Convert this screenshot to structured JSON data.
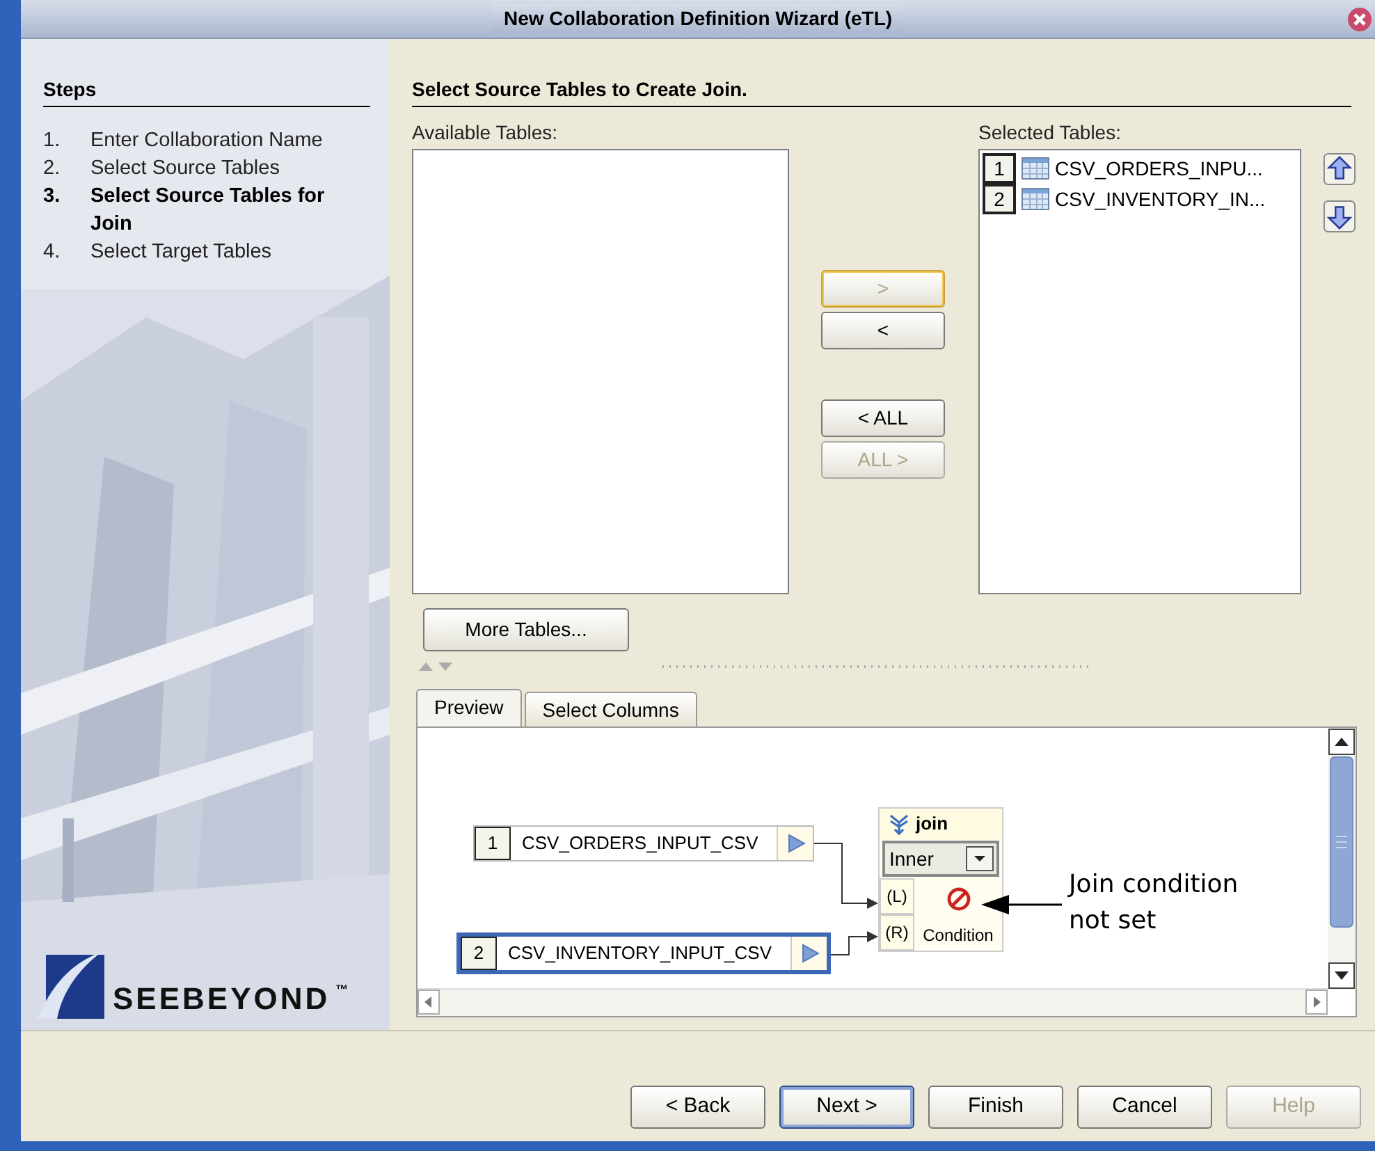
{
  "window": {
    "title": "New Collaboration Definition Wizard (eTL)"
  },
  "steps": {
    "heading": "Steps",
    "items": [
      {
        "number": "1.",
        "label": "Enter Collaboration Name",
        "selected": false
      },
      {
        "number": "2.",
        "label": "Select Source Tables",
        "selected": false
      },
      {
        "number": "3.",
        "label": "Select Source Tables for Join",
        "selected": true
      },
      {
        "number": "4.",
        "label": "Select Target Tables",
        "selected": false
      }
    ]
  },
  "logo": {
    "text": "SEEBEYOND",
    "mark": "™"
  },
  "page": {
    "heading": "Select Source Tables to Create Join."
  },
  "available_tables": {
    "label": "Available Tables:"
  },
  "selected_tables": {
    "label": "Selected Tables:",
    "rows": [
      {
        "index": "1",
        "name": "CSV_ORDERS_INPU..."
      },
      {
        "index": "2",
        "name": "CSV_INVENTORY_IN..."
      }
    ]
  },
  "transfer_buttons": [
    {
      "label": ">",
      "disabled": true,
      "focused": true
    },
    {
      "label": "<",
      "disabled": false,
      "focused": false
    },
    {
      "label": "< ALL",
      "disabled": false,
      "focused": false
    },
    {
      "label": "ALL >",
      "disabled": true,
      "focused": false
    }
  ],
  "more_tables_button": "More Tables...",
  "tabs": [
    {
      "label": "Preview",
      "selected": true
    },
    {
      "label": "Select Columns",
      "selected": false
    }
  ],
  "diagram": {
    "tables": [
      {
        "index": "1",
        "name": "CSV_ORDERS_INPUT_CSV",
        "selected": false
      },
      {
        "index": "2",
        "name": "CSV_INVENTORY_INPUT_CSV",
        "selected": true
      }
    ],
    "join": {
      "title": "join",
      "type": "Inner",
      "left": "(L)",
      "right": "(R)",
      "condition": "Condition"
    },
    "annotation": "Join condition not set"
  },
  "buttons": [
    {
      "label": "< Back",
      "disabled": false,
      "default": false
    },
    {
      "label": "Next >",
      "disabled": false,
      "default": true
    },
    {
      "label": "Finish",
      "disabled": false,
      "default": false
    },
    {
      "label": "Cancel",
      "disabled": false,
      "default": false
    },
    {
      "label": "Help",
      "disabled": true,
      "default": false
    }
  ]
}
